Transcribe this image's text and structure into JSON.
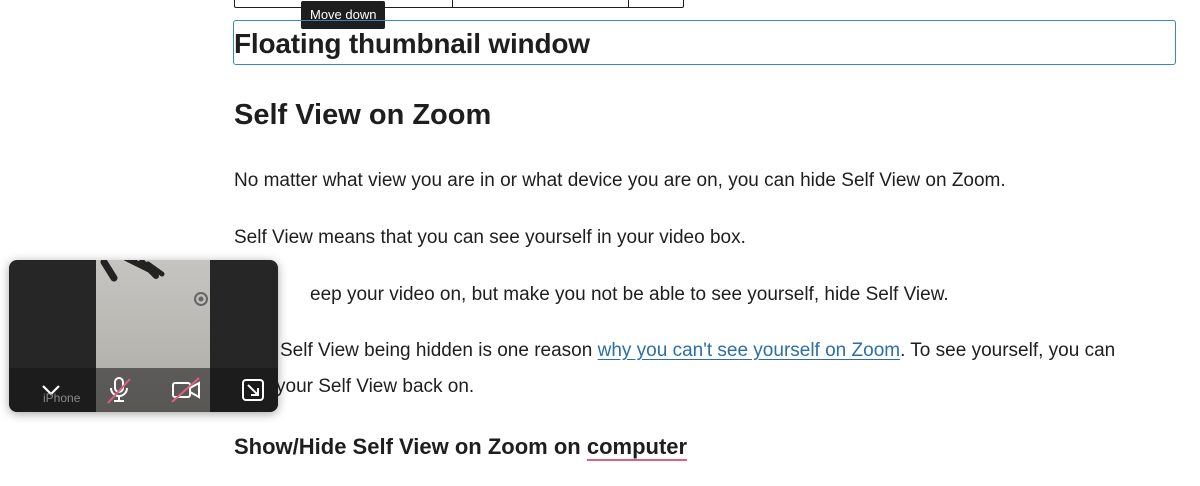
{
  "tooltip": {
    "text": "Move down"
  },
  "selected_heading": "Floating thumbnail window",
  "section_title": "Self View on Zoom",
  "paragraphs": {
    "p1": "No matter what view you are in or what device you are on, you can hide Self View on Zoom.",
    "p2": "Self View means that you can see yourself in your video box.",
    "p3": "eep your video on, but make you not be able to see yourself, hide Self View.",
    "p4_before": "Self View being hidden is one reason ",
    "p4_link": "why you can't see yourself on Zoom",
    "p4_after": ". To see yourself, you can",
    "p4_line2": "your Self View back on."
  },
  "subsection": {
    "before": "Show/Hide Self View on Zoom on ",
    "flagged": "computer"
  },
  "thumbnail": {
    "participant_name": "iPhone",
    "controls": [
      "chevron-down-icon",
      "mic-muted-icon",
      "video-off-icon",
      "exit-minimize-icon"
    ]
  },
  "colors": {
    "accent": "#3a86c8",
    "link": "#2b6ea8",
    "tooltip_bg": "#1e1e1e",
    "thumbnail_bg": "#262626",
    "muted_slash": "#e06080"
  }
}
